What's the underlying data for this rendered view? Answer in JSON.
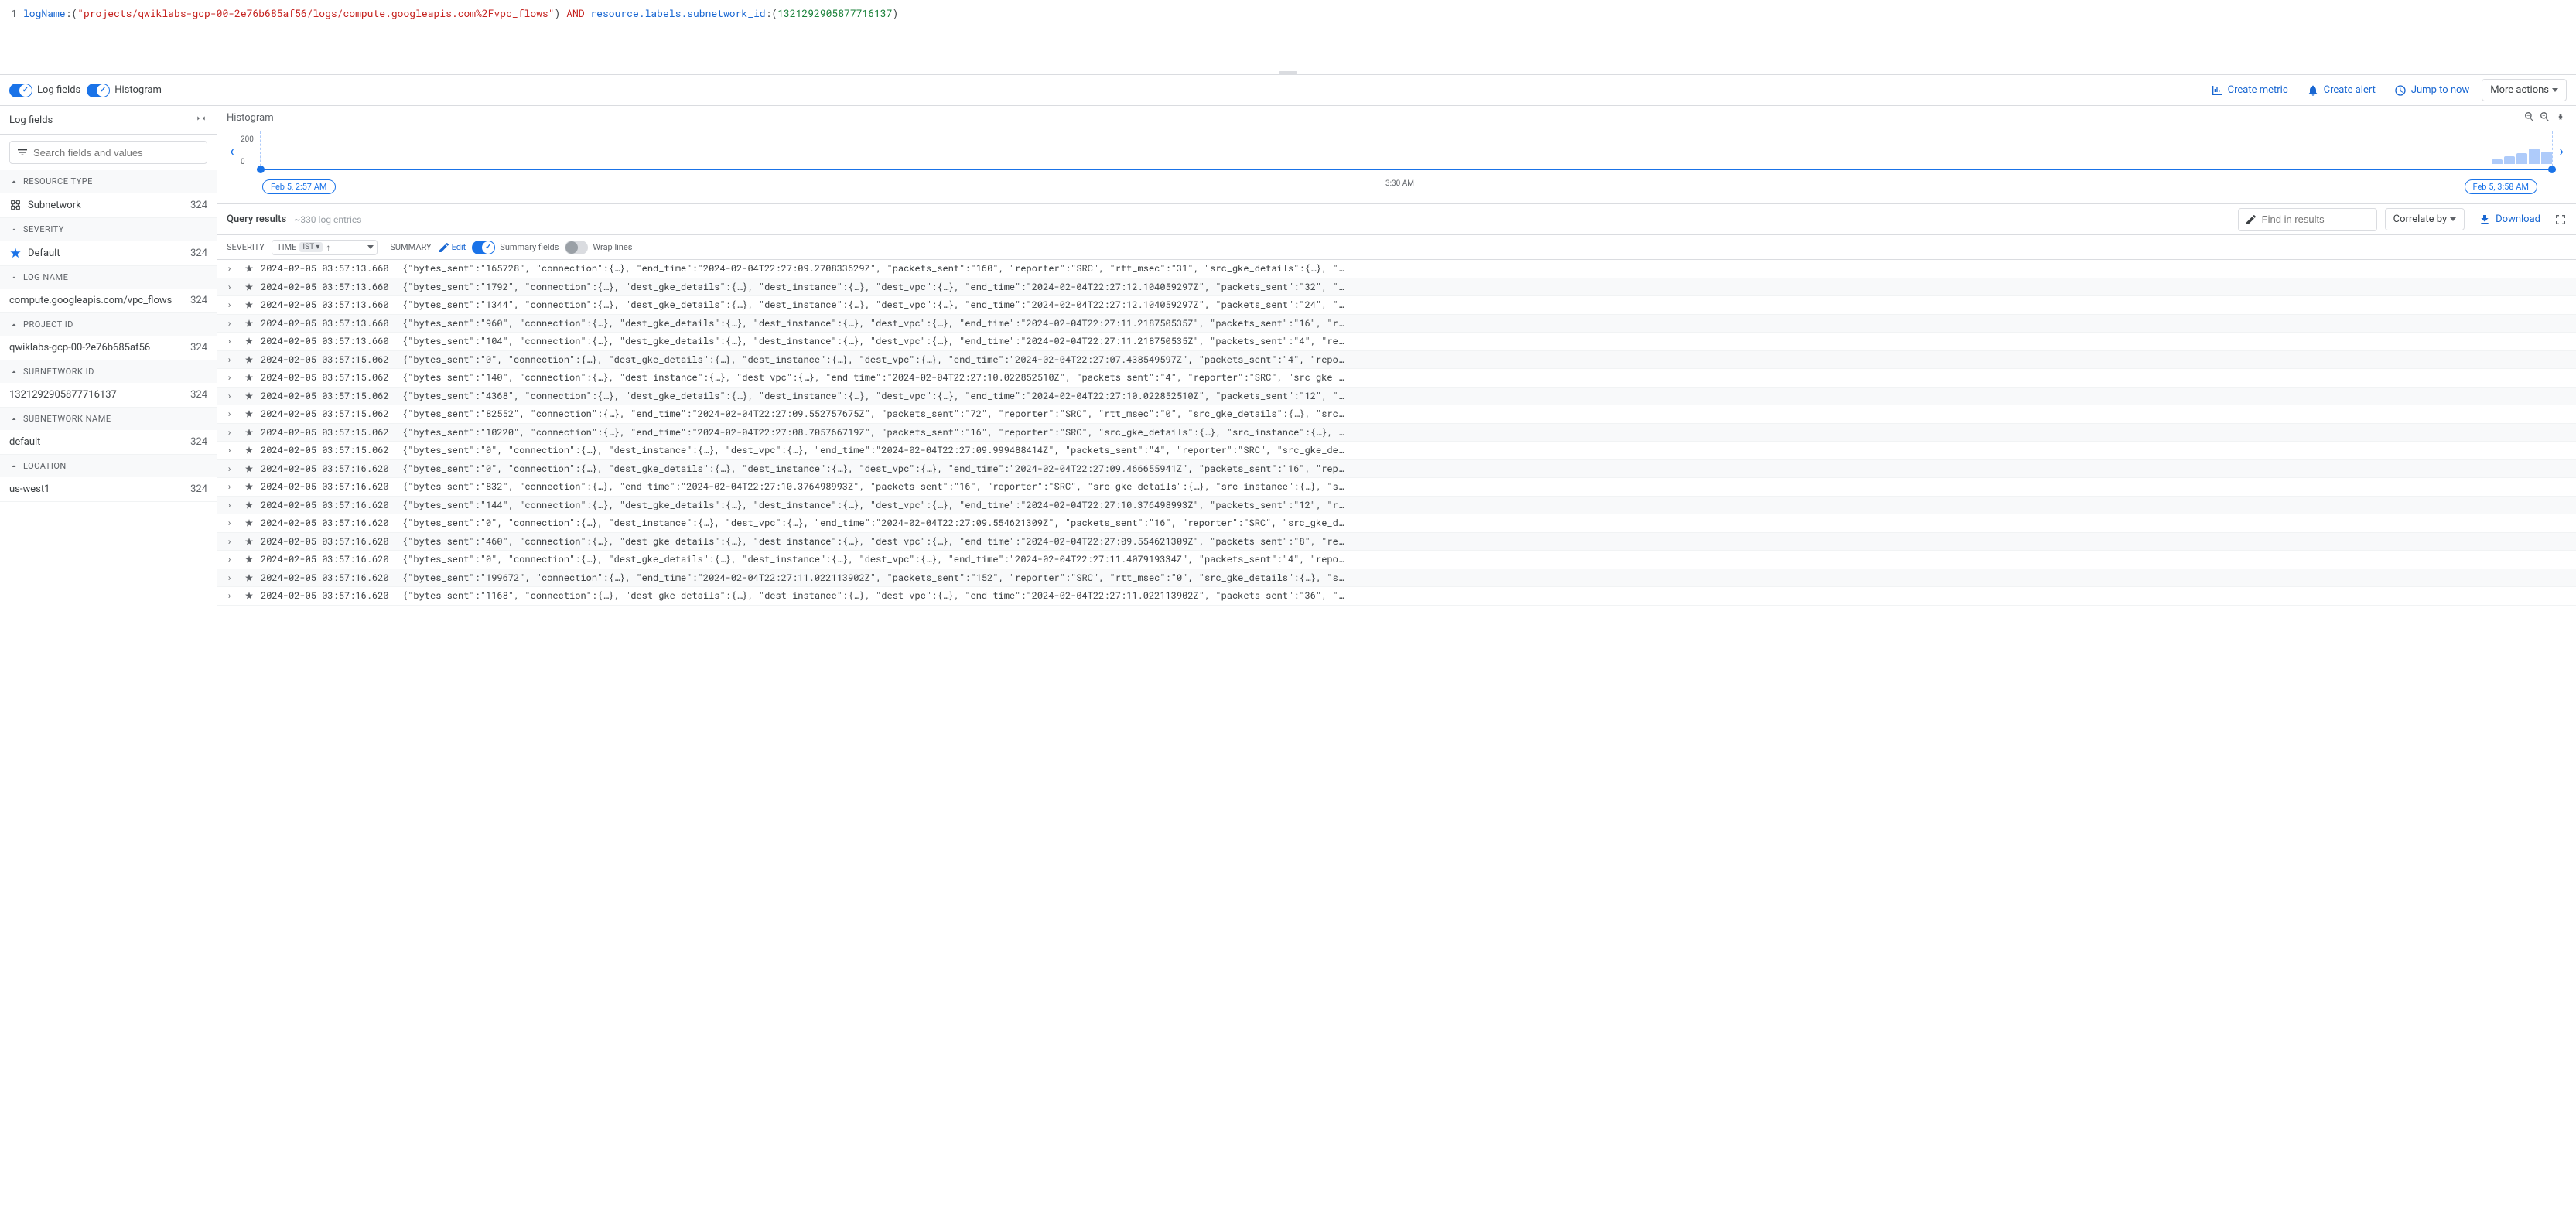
{
  "query": {
    "logName_key": "logName",
    "logName_value": "\"projects/qwiklabs-gcp-00-2e76b685af56/logs/compute.googleapis.com%2Fvpc_flows\"",
    "and": "AND",
    "resource_key": "resource.labels.subnetwork_id",
    "resource_value": "1321292905877716137"
  },
  "toolbar": {
    "logFields": "Log fields",
    "histogram": "Histogram",
    "createMetric": "Create metric",
    "createAlert": "Create alert",
    "jumpToNow": "Jump to now",
    "moreActions": "More actions"
  },
  "sidebar": {
    "title": "Log fields",
    "searchPlaceholder": "Search fields and values",
    "facets": [
      {
        "title": "RESOURCE TYPE",
        "items": [
          {
            "label": "Subnetwork",
            "count": "324",
            "icon": "net"
          }
        ]
      },
      {
        "title": "SEVERITY",
        "items": [
          {
            "label": "Default",
            "count": "324",
            "icon": "star"
          }
        ]
      },
      {
        "title": "LOG NAME",
        "items": [
          {
            "label": "compute.googleapis.com/vpc_flows",
            "count": "324"
          }
        ]
      },
      {
        "title": "PROJECT ID",
        "items": [
          {
            "label": "qwiklabs-gcp-00-2e76b685af56",
            "count": "324"
          }
        ]
      },
      {
        "title": "SUBNETWORK ID",
        "items": [
          {
            "label": "1321292905877716137",
            "count": "324"
          }
        ]
      },
      {
        "title": "SUBNETWORK NAME",
        "items": [
          {
            "label": "default",
            "count": "324"
          }
        ]
      },
      {
        "title": "LOCATION",
        "items": [
          {
            "label": "us-west1",
            "count": "324"
          }
        ]
      }
    ]
  },
  "histogram": {
    "title": "Histogram",
    "yMax": "200",
    "yMin": "0",
    "startChip": "Feb 5, 2:57 AM",
    "midLabel": "3:30 AM",
    "endChip": "Feb 5, 3:58 AM",
    "bars": [
      6,
      10,
      14,
      20,
      16
    ]
  },
  "results": {
    "title": "Query results",
    "count": "~330 log entries",
    "findPlaceholder": "Find in results",
    "correlate": "Correlate by",
    "download": "Download"
  },
  "tableHeader": {
    "severity": "SEVERITY",
    "time": "TIME",
    "tz": "IST",
    "summary": "SUMMARY",
    "edit": "Edit",
    "summaryFields": "Summary fields",
    "wrapLines": "Wrap lines"
  },
  "rows": [
    {
      "ts": "2024-02-05 03:57:13.660",
      "sum": "{\"bytes_sent\":\"165728\", \"connection\":{…}, \"end_time\":\"2024-02-04T22:27:09.270833629Z\", \"packets_sent\":\"160\", \"reporter\":\"SRC\", \"rtt_msec\":\"31\", \"src_gke_details\":{…}, \"…"
    },
    {
      "ts": "2024-02-05 03:57:13.660",
      "sum": "{\"bytes_sent\":\"1792\", \"connection\":{…}, \"dest_gke_details\":{…}, \"dest_instance\":{…}, \"dest_vpc\":{…}, \"end_time\":\"2024-02-04T22:27:12.104059297Z\", \"packets_sent\":\"32\", \"…"
    },
    {
      "ts": "2024-02-05 03:57:13.660",
      "sum": "{\"bytes_sent\":\"1344\", \"connection\":{…}, \"dest_gke_details\":{…}, \"dest_instance\":{…}, \"dest_vpc\":{…}, \"end_time\":\"2024-02-04T22:27:12.104059297Z\", \"packets_sent\":\"24\", \"…"
    },
    {
      "ts": "2024-02-05 03:57:13.660",
      "sum": "{\"bytes_sent\":\"960\", \"connection\":{…}, \"dest_gke_details\":{…}, \"dest_instance\":{…}, \"dest_vpc\":{…}, \"end_time\":\"2024-02-04T22:27:11.218750535Z\", \"packets_sent\":\"16\", \"r…"
    },
    {
      "ts": "2024-02-05 03:57:13.660",
      "sum": "{\"bytes_sent\":\"104\", \"connection\":{…}, \"dest_gke_details\":{…}, \"dest_instance\":{…}, \"dest_vpc\":{…}, \"end_time\":\"2024-02-04T22:27:11.218750535Z\", \"packets_sent\":\"4\", \"re…"
    },
    {
      "ts": "2024-02-05 03:57:15.062",
      "sum": "{\"bytes_sent\":\"0\", \"connection\":{…}, \"dest_gke_details\":{…}, \"dest_instance\":{…}, \"dest_vpc\":{…}, \"end_time\":\"2024-02-04T22:27:07.438549597Z\", \"packets_sent\":\"4\", \"repo…"
    },
    {
      "ts": "2024-02-05 03:57:15.062",
      "sum": "{\"bytes_sent\":\"140\", \"connection\":{…}, \"dest_instance\":{…}, \"dest_vpc\":{…}, \"end_time\":\"2024-02-04T22:27:10.022852510Z\", \"packets_sent\":\"4\", \"reporter\":\"SRC\", \"src_gke_…"
    },
    {
      "ts": "2024-02-05 03:57:15.062",
      "sum": "{\"bytes_sent\":\"4368\", \"connection\":{…}, \"dest_gke_details\":{…}, \"dest_instance\":{…}, \"dest_vpc\":{…}, \"end_time\":\"2024-02-04T22:27:10.022852510Z\", \"packets_sent\":\"12\", \"…"
    },
    {
      "ts": "2024-02-05 03:57:15.062",
      "sum": "{\"bytes_sent\":\"82552\", \"connection\":{…}, \"end_time\":\"2024-02-04T22:27:09.552757675Z\", \"packets_sent\":\"72\", \"reporter\":\"SRC\", \"rtt_msec\":\"0\", \"src_gke_details\":{…}, \"src…"
    },
    {
      "ts": "2024-02-05 03:57:15.062",
      "sum": "{\"bytes_sent\":\"10220\", \"connection\":{…}, \"end_time\":\"2024-02-04T22:27:08.705766719Z\", \"packets_sent\":\"16\", \"reporter\":\"SRC\", \"src_gke_details\":{…}, \"src_instance\":{…}, …"
    },
    {
      "ts": "2024-02-05 03:57:15.062",
      "sum": "{\"bytes_sent\":\"0\", \"connection\":{…}, \"dest_instance\":{…}, \"dest_vpc\":{…}, \"end_time\":\"2024-02-04T22:27:09.999488414Z\", \"packets_sent\":\"4\", \"reporter\":\"SRC\", \"src_gke_de…"
    },
    {
      "ts": "2024-02-05 03:57:16.620",
      "sum": "{\"bytes_sent\":\"0\", \"connection\":{…}, \"dest_gke_details\":{…}, \"dest_instance\":{…}, \"dest_vpc\":{…}, \"end_time\":\"2024-02-04T22:27:09.466655941Z\", \"packets_sent\":\"16\", \"rep…"
    },
    {
      "ts": "2024-02-05 03:57:16.620",
      "sum": "{\"bytes_sent\":\"832\", \"connection\":{…}, \"end_time\":\"2024-02-04T22:27:10.376498993Z\", \"packets_sent\":\"16\", \"reporter\":\"SRC\", \"src_gke_details\":{…}, \"src_instance\":{…}, \"s…"
    },
    {
      "ts": "2024-02-05 03:57:16.620",
      "sum": "{\"bytes_sent\":\"144\", \"connection\":{…}, \"dest_gke_details\":{…}, \"dest_instance\":{…}, \"dest_vpc\":{…}, \"end_time\":\"2024-02-04T22:27:10.376498993Z\", \"packets_sent\":\"12\", \"r…"
    },
    {
      "ts": "2024-02-05 03:57:16.620",
      "sum": "{\"bytes_sent\":\"0\", \"connection\":{…}, \"dest_instance\":{…}, \"dest_vpc\":{…}, \"end_time\":\"2024-02-04T22:27:09.554621309Z\", \"packets_sent\":\"16\", \"reporter\":\"SRC\", \"src_gke_d…"
    },
    {
      "ts": "2024-02-05 03:57:16.620",
      "sum": "{\"bytes_sent\":\"460\", \"connection\":{…}, \"dest_gke_details\":{…}, \"dest_instance\":{…}, \"dest_vpc\":{…}, \"end_time\":\"2024-02-04T22:27:09.554621309Z\", \"packets_sent\":\"8\", \"re…"
    },
    {
      "ts": "2024-02-05 03:57:16.620",
      "sum": "{\"bytes_sent\":\"0\", \"connection\":{…}, \"dest_gke_details\":{…}, \"dest_instance\":{…}, \"dest_vpc\":{…}, \"end_time\":\"2024-02-04T22:27:11.407919334Z\", \"packets_sent\":\"4\", \"repo…"
    },
    {
      "ts": "2024-02-05 03:57:16.620",
      "sum": "{\"bytes_sent\":\"199672\", \"connection\":{…}, \"end_time\":\"2024-02-04T22:27:11.022113902Z\", \"packets_sent\":\"152\", \"reporter\":\"SRC\", \"rtt_msec\":\"0\", \"src_gke_details\":{…}, \"s…"
    },
    {
      "ts": "2024-02-05 03:57:16.620",
      "sum": "{\"bytes_sent\":\"1168\", \"connection\":{…}, \"dest_gke_details\":{…}, \"dest_instance\":{…}, \"dest_vpc\":{…}, \"end_time\":\"2024-02-04T22:27:11.022113902Z\", \"packets_sent\":\"36\", \"…"
    }
  ]
}
